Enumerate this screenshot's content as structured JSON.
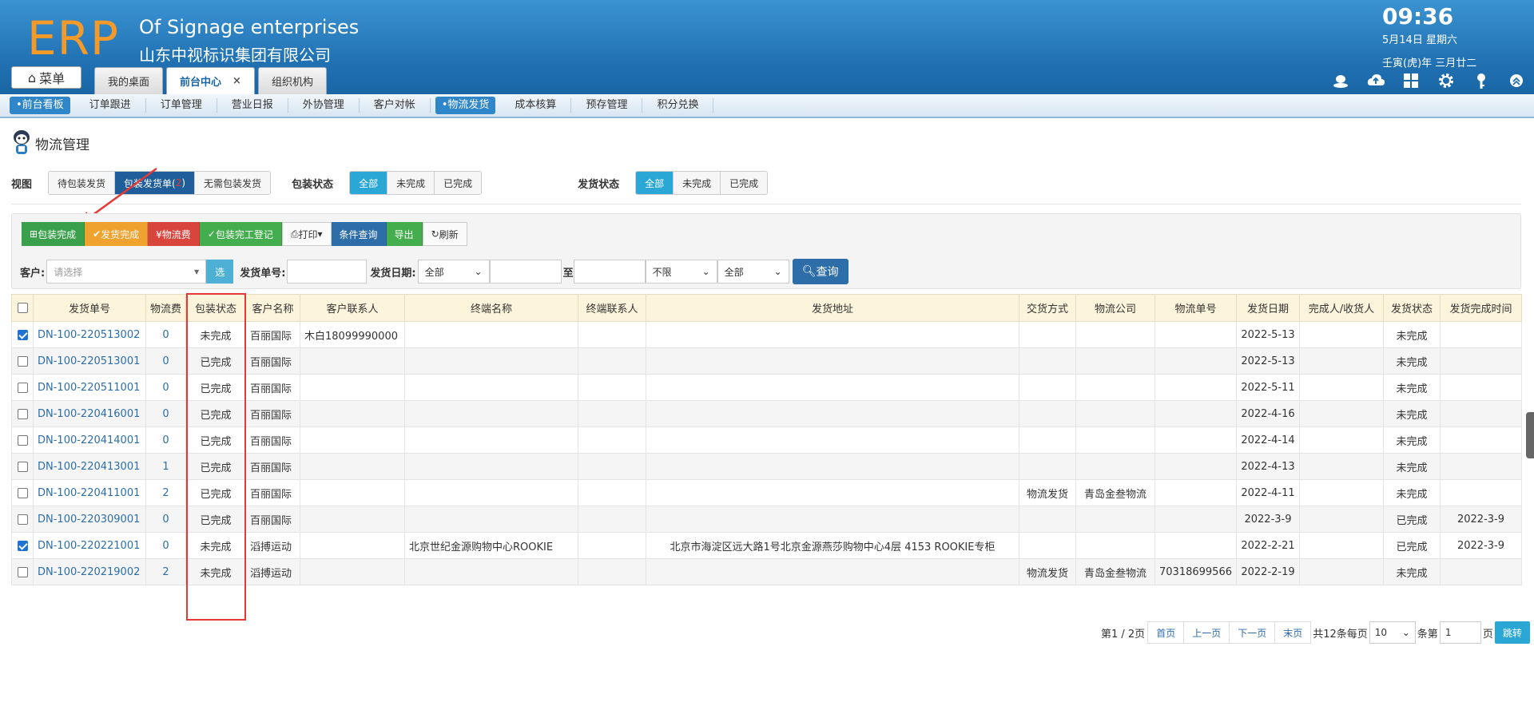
{
  "header": {
    "logo": "ERP",
    "company_en": "Of Signage enterprises",
    "company_cn": "山东中视标识集团有限公司",
    "time": "09:36",
    "date": "5月14日 星期六",
    "lunar": "壬寅(虎)年 三月廿二",
    "menu_label": "菜单",
    "tabs": [
      {
        "label": "我的桌面"
      },
      {
        "label": "前台中心",
        "close": "×"
      },
      {
        "label": "组织机构"
      }
    ]
  },
  "subnav": [
    "•前台看板",
    "订单跟进",
    "订单管理",
    "营业日报",
    "外协管理",
    "客户对帐",
    "•物流发货",
    "成本核算",
    "预存管理",
    "积分兑换"
  ],
  "page": {
    "title": "物流管理",
    "view_label": "视图",
    "view_options": [
      "待包装发货",
      "包装发货单(",
      "2",
      ")",
      "无需包装发货"
    ],
    "pack_status_label": "包装状态",
    "pack_status_options": [
      "全部",
      "未完成",
      "已完成"
    ],
    "ship_status_label": "发货状态",
    "ship_status_options": [
      "全部",
      "未完成",
      "已完成"
    ]
  },
  "toolbar": [
    "包装完成",
    "发货完成",
    "¥物流费",
    "包装完工登记",
    "打印",
    "条件查询",
    "导出",
    "刷新"
  ],
  "search": {
    "customer_label": "客户:",
    "customer_placeholder": "请选择",
    "select_btn": "选",
    "order_no_label": "发货单号:",
    "ship_date_label": "发货日期:",
    "date_scope": "全部",
    "to_label": "至",
    "limit": "不限",
    "all": "全部",
    "query_btn": "查询"
  },
  "table": {
    "columns": [
      "发货单号",
      "物流费",
      "包装状态",
      "客户名称",
      "客户联系人",
      "终端名称",
      "终端联系人",
      "发货地址",
      "交货方式",
      "物流公司",
      "物流单号",
      "发货日期",
      "完成人/收货人",
      "发货状态",
      "发货完成时间"
    ],
    "rows": [
      {
        "checked": true,
        "no": "DN-100-220513002",
        "fee": "0",
        "pack": "未完成",
        "customer": "百丽国际",
        "contact": "木白18099990000",
        "terminal": "",
        "tcontact": "",
        "address": "",
        "delivery": "",
        "company": "",
        "tracking": "",
        "date": "2022-5-13",
        "receiver": "",
        "ship": "未完成",
        "done_time": ""
      },
      {
        "checked": false,
        "no": "DN-100-220513001",
        "fee": "0",
        "pack": "已完成",
        "customer": "百丽国际",
        "contact": "",
        "terminal": "",
        "tcontact": "",
        "address": "",
        "delivery": "",
        "company": "",
        "tracking": "",
        "date": "2022-5-13",
        "receiver": "",
        "ship": "未完成",
        "done_time": ""
      },
      {
        "checked": false,
        "no": "DN-100-220511001",
        "fee": "0",
        "pack": "已完成",
        "customer": "百丽国际",
        "contact": "",
        "terminal": "",
        "tcontact": "",
        "address": "",
        "delivery": "",
        "company": "",
        "tracking": "",
        "date": "2022-5-11",
        "receiver": "",
        "ship": "未完成",
        "done_time": ""
      },
      {
        "checked": false,
        "no": "DN-100-220416001",
        "fee": "0",
        "pack": "已完成",
        "customer": "百丽国际",
        "contact": "",
        "terminal": "",
        "tcontact": "",
        "address": "",
        "delivery": "",
        "company": "",
        "tracking": "",
        "date": "2022-4-16",
        "receiver": "",
        "ship": "未完成",
        "done_time": ""
      },
      {
        "checked": false,
        "no": "DN-100-220414001",
        "fee": "0",
        "pack": "已完成",
        "customer": "百丽国际",
        "contact": "",
        "terminal": "",
        "tcontact": "",
        "address": "",
        "delivery": "",
        "company": "",
        "tracking": "",
        "date": "2022-4-14",
        "receiver": "",
        "ship": "未完成",
        "done_time": ""
      },
      {
        "checked": false,
        "no": "DN-100-220413001",
        "fee": "1",
        "pack": "已完成",
        "customer": "百丽国际",
        "contact": "",
        "terminal": "",
        "tcontact": "",
        "address": "",
        "delivery": "",
        "company": "",
        "tracking": "",
        "date": "2022-4-13",
        "receiver": "",
        "ship": "未完成",
        "done_time": ""
      },
      {
        "checked": false,
        "no": "DN-100-220411001",
        "fee": "2",
        "pack": "已完成",
        "customer": "百丽国际",
        "contact": "",
        "terminal": "",
        "tcontact": "",
        "address": "",
        "delivery": "物流发货",
        "company": "青岛金叁物流",
        "tracking": "",
        "date": "2022-4-11",
        "receiver": "",
        "ship": "未完成",
        "done_time": ""
      },
      {
        "checked": false,
        "no": "DN-100-220309001",
        "fee": "0",
        "pack": "已完成",
        "customer": "百丽国际",
        "contact": "",
        "terminal": "",
        "tcontact": "",
        "address": "",
        "delivery": "",
        "company": "",
        "tracking": "",
        "date": "2022-3-9",
        "receiver": "",
        "ship": "已完成",
        "done_time": "2022-3-9"
      },
      {
        "checked": true,
        "no": "DN-100-220221001",
        "fee": "0",
        "pack": "未完成",
        "customer": "滔搏运动",
        "contact": "",
        "terminal": "北京世纪金源购物中心ROOKIE",
        "tcontact": "",
        "address": "北京市海淀区远大路1号北京金源燕莎购物中心4层 4153 ROOKIE专柜",
        "delivery": "",
        "company": "",
        "tracking": "",
        "date": "2022-2-21",
        "receiver": "",
        "ship": "已完成",
        "done_time": "2022-3-9"
      },
      {
        "checked": false,
        "no": "DN-100-220219002",
        "fee": "2",
        "pack": "未完成",
        "customer": "滔搏运动",
        "contact": "",
        "terminal": "",
        "tcontact": "",
        "address": "",
        "delivery": "物流发货",
        "company": "青岛金叁物流",
        "tracking": "70318699566",
        "date": "2022-2-19",
        "receiver": "",
        "ship": "未完成",
        "done_time": ""
      }
    ]
  },
  "pager": {
    "page_info": "第1 / 2页",
    "first": "首页",
    "prev": "上一页",
    "next": "下一页",
    "last": "末页",
    "total": "共12条每页",
    "per_page": "10",
    "per_unit": "条第",
    "page_input": "1",
    "page_unit": "页",
    "go": "跳转"
  },
  "colors": {
    "red": "#e53935",
    "blue": "#2d3ff0",
    "brand": "#1f6fb1",
    "logo": "#f39a2a"
  }
}
